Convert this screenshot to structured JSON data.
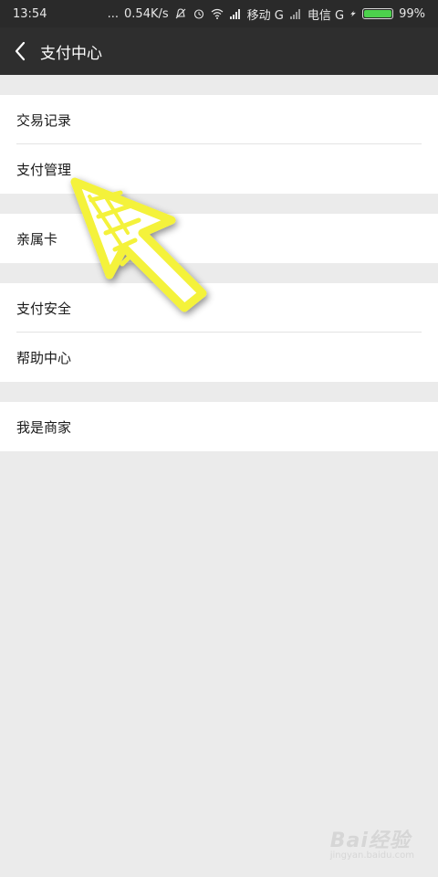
{
  "status_bar": {
    "time": "13:54",
    "dots": "...",
    "speed": "0.54K/s",
    "carrier1": "移动 G",
    "carrier2": "电信 G",
    "battery": "99%",
    "battery_level": 0.99,
    "icons": [
      "bell-off-icon",
      "alarm-icon",
      "wifi-icon",
      "signal-icon",
      "signal-icon",
      "charging-icon"
    ]
  },
  "nav": {
    "title": "支付中心",
    "back_icon": "chevron-left-icon"
  },
  "groups": [
    {
      "items": [
        {
          "label": "交易记录"
        },
        {
          "label": "支付管理"
        }
      ]
    },
    {
      "items": [
        {
          "label": "亲属卡"
        }
      ]
    },
    {
      "items": [
        {
          "label": "支付安全"
        },
        {
          "label": "帮助中心"
        }
      ]
    },
    {
      "items": [
        {
          "label": "我是商家"
        }
      ]
    }
  ],
  "annotation": {
    "icon": "pointer-arrow-icon",
    "color": "#f4f23a"
  },
  "watermark": {
    "brand": "Bai经验",
    "sub": "jingyan.baidu.com"
  },
  "colors": {
    "status_bg": "#2a2a2a",
    "nav_bg": "#2e2e2e",
    "page_bg": "#ebebeb",
    "battery_fill": "#4cd14c"
  }
}
